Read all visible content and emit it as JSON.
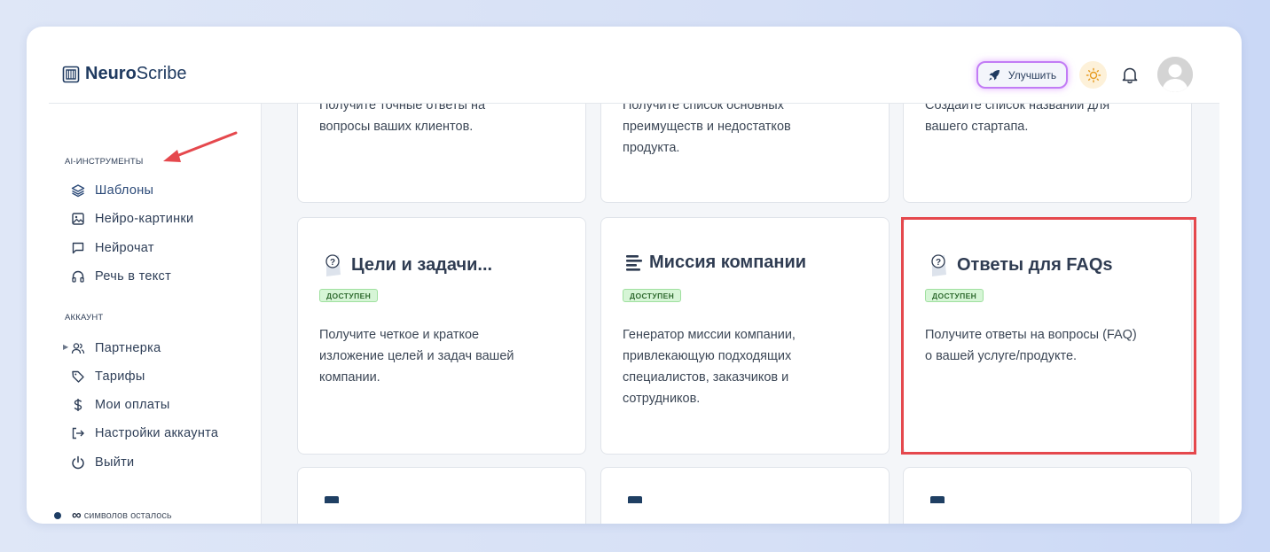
{
  "app": {
    "logo_bold": "Neuro",
    "logo_regular": "Scribe"
  },
  "header": {
    "upgrade_label": "Улучшить",
    "upgrade_border_color": "#c27cf5"
  },
  "sidebar": {
    "sections": [
      {
        "label": "AI-ИНСТРУМЕНТЫ",
        "items": [
          {
            "label": "Шаблоны",
            "icon": "layers-icon",
            "active": true
          },
          {
            "label": "Нейро-картинки",
            "icon": "image-icon"
          },
          {
            "label": "Нейрочат",
            "icon": "chat-icon"
          },
          {
            "label": "Речь в текст",
            "icon": "headphones-icon"
          }
        ]
      },
      {
        "label": "АККАУНТ",
        "items": [
          {
            "label": "Партнерка",
            "icon": "users-icon",
            "expandable": true
          },
          {
            "label": "Тарифы",
            "icon": "tag-icon"
          },
          {
            "label": "Мои оплаты",
            "icon": "dollar-icon"
          },
          {
            "label": "Настройки аккаунта",
            "icon": "logout-arrow-icon"
          },
          {
            "label": "Выйти",
            "icon": "power-icon"
          }
        ]
      }
    ],
    "remaining_value": "∞",
    "remaining_text": "символов осталось"
  },
  "cards": {
    "row1": [
      {
        "line1": "Получите точные ответы на",
        "line2": "вопросы ваших клиентов."
      },
      {
        "line1": "Получите список основных",
        "line2": "преимуществ и недостатков",
        "line3": "продукта."
      },
      {
        "line1": "Создайте список названий для",
        "line2": "вашего стартапа."
      }
    ],
    "row2": [
      {
        "title": "Цели и задачи...",
        "icon": "question-doc-icon",
        "badge": "ДОСТУПЕН",
        "desc": [
          "Получите четкое и краткое",
          "изложение целей и задач вашей",
          "компании."
        ]
      },
      {
        "title": "Миссия компании",
        "icon": "text-lines-icon",
        "badge": "ДОСТУПЕН",
        "desc": [
          "Генератор миссии компании,",
          "привлекающую подходящих",
          "специалистов, заказчиков и",
          "сотрудников."
        ]
      },
      {
        "title": "Ответы для FAQs",
        "icon": "question-doc-icon",
        "badge": "ДОСТУПЕН",
        "desc": [
          "Получите ответы на вопросы (FAQ)",
          "о вашей услуге/продукте."
        ]
      }
    ]
  },
  "colors": {
    "accent": "#1f3a60",
    "badge_bg": "#d6f5d6",
    "highlight": "#e5484d",
    "arrow": "#e5484d"
  }
}
